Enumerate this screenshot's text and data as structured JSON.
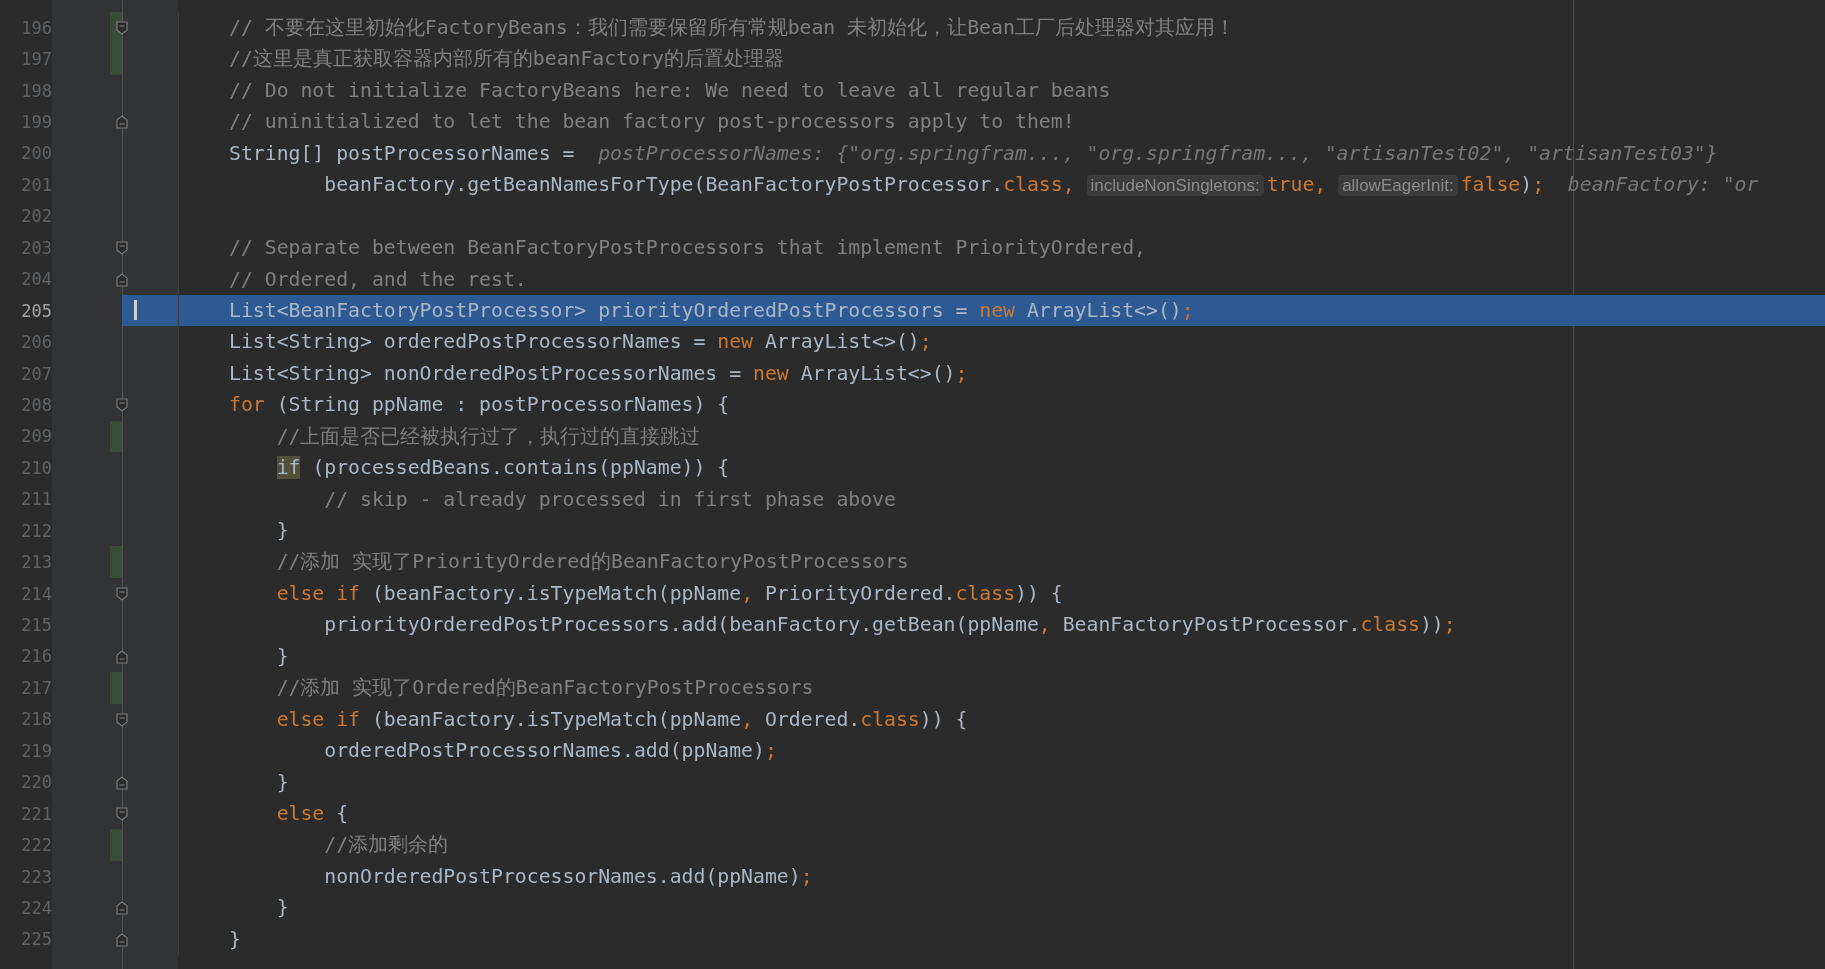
{
  "editor": {
    "lines": [
      {
        "number": "196",
        "changed": true,
        "kind": "fold-start",
        "selected": false,
        "tokens": [
          {
            "kind": "comment",
            "text": "// 不要在这里初始化FactoryBeans：我们需要保留所有常规bean 未初始化，让Bean工厂后处理器对其应用！"
          }
        ]
      },
      {
        "number": "197",
        "changed": true,
        "kind": "plain",
        "selected": false,
        "tokens": [
          {
            "kind": "comment",
            "text": "//这里是真正获取容器内部所有的beanFactory的后置处理器"
          }
        ]
      },
      {
        "number": "198",
        "changed": false,
        "kind": "plain",
        "selected": false,
        "tokens": [
          {
            "kind": "comment",
            "text": "// Do not initialize FactoryBeans here: We need to leave all regular beans"
          }
        ]
      },
      {
        "number": "199",
        "changed": false,
        "kind": "fold-end",
        "selected": false,
        "tokens": [
          {
            "kind": "comment",
            "text": "// uninitialized to let the bean factory post-processors apply to them!"
          }
        ]
      },
      {
        "number": "200",
        "changed": false,
        "kind": "plain",
        "selected": false,
        "tokens": [
          {
            "kind": "code",
            "text": "String[] postProcessorNames =  "
          },
          {
            "kind": "hint",
            "text": "postProcessorNames: {\"org.springfram..., \"org.springfram..., \"artisanTest02\", \"artisanTest03\"}"
          }
        ]
      },
      {
        "number": "201",
        "changed": false,
        "kind": "plain",
        "selected": false,
        "tokens": [
          {
            "kind": "code",
            "text": "        beanFactory.getBeanNamesForType(BeanFactoryPostProcessor."
          },
          {
            "kind": "keyword",
            "text": "class, "
          },
          {
            "kind": "inlay",
            "text": "includeNonSingletons:"
          },
          {
            "kind": "keyword",
            "text": "true, "
          },
          {
            "kind": "inlay",
            "text": "allowEagerInit:"
          },
          {
            "kind": "keyword",
            "text": "false"
          },
          {
            "kind": "code",
            "text": ")"
          },
          {
            "kind": "keyword",
            "text": ";  "
          },
          {
            "kind": "hint",
            "text": "beanFactory: \"or"
          }
        ]
      },
      {
        "number": "202",
        "changed": false,
        "kind": "plain",
        "selected": false
      },
      {
        "number": "203",
        "changed": false,
        "kind": "fold-start",
        "selected": false,
        "tokens": [
          {
            "kind": "comment",
            "text": "// Separate between BeanFactoryPostProcessors that implement PriorityOrdered,"
          }
        ]
      },
      {
        "number": "204",
        "changed": false,
        "kind": "fold-end",
        "selected": false,
        "tokens": [
          {
            "kind": "comment",
            "text": "// Ordered, and the rest."
          }
        ]
      },
      {
        "number": "205",
        "changed": false,
        "kind": "plain",
        "selected": true,
        "tokens": [
          {
            "kind": "code",
            "text": "List<BeanFactoryPostProcessor> priorityOrderedPostProcessors = "
          },
          {
            "kind": "keyword",
            "text": "new "
          },
          {
            "kind": "code",
            "text": "ArrayList<>()"
          },
          {
            "kind": "keyword",
            "text": ";"
          }
        ]
      },
      {
        "number": "206",
        "changed": false,
        "kind": "plain",
        "selected": false,
        "tokens": [
          {
            "kind": "code",
            "text": "List<String> orderedPostProcessorNames = "
          },
          {
            "kind": "keyword",
            "text": "new "
          },
          {
            "kind": "code",
            "text": "ArrayList<>()"
          },
          {
            "kind": "keyword",
            "text": ";"
          }
        ]
      },
      {
        "number": "207",
        "changed": false,
        "kind": "plain",
        "selected": false,
        "tokens": [
          {
            "kind": "code",
            "text": "List<String> nonOrderedPostProcessorNames = "
          },
          {
            "kind": "keyword",
            "text": "new "
          },
          {
            "kind": "code",
            "text": "ArrayList<>()"
          },
          {
            "kind": "keyword",
            "text": ";"
          }
        ]
      },
      {
        "number": "208",
        "changed": false,
        "kind": "fold-start",
        "selected": false,
        "tokens": [
          {
            "kind": "keyword",
            "text": "for "
          },
          {
            "kind": "code",
            "text": "(String ppName : postProcessorNames) {"
          }
        ]
      },
      {
        "number": "209",
        "changed": true,
        "kind": "plain",
        "selected": false,
        "tokens": [
          {
            "kind": "comment",
            "text": "    //上面是否已经被执行过了，执行过的直接跳过"
          }
        ]
      },
      {
        "number": "210",
        "changed": false,
        "kind": "plain",
        "selected": false,
        "tokens": [
          {
            "kind": "match",
            "text": "    if"
          },
          {
            "kind": "code",
            "text": " (processedBeans.contains(ppName)) {"
          }
        ]
      },
      {
        "number": "211",
        "changed": false,
        "kind": "plain",
        "selected": false,
        "tokens": [
          {
            "kind": "comment",
            "text": "        // skip - already processed in first phase above"
          }
        ]
      },
      {
        "number": "212",
        "changed": false,
        "kind": "plain",
        "selected": false,
        "tokens": [
          {
            "kind": "code",
            "text": "    }"
          }
        ]
      },
      {
        "number": "213",
        "changed": true,
        "kind": "plain",
        "selected": false,
        "tokens": [
          {
            "kind": "comment",
            "text": "    //添加 实现了PriorityOrdered的BeanFactoryPostProcessors"
          }
        ]
      },
      {
        "number": "214",
        "changed": false,
        "kind": "fold-start",
        "selected": false,
        "tokens": [
          {
            "kind": "keyword",
            "text": "    else if "
          },
          {
            "kind": "code",
            "text": "(beanFactory.isTypeMatch(ppName"
          },
          {
            "kind": "keyword",
            "text": ", "
          },
          {
            "kind": "code",
            "text": "PriorityOrdered."
          },
          {
            "kind": "keyword",
            "text": "class"
          },
          {
            "kind": "code",
            "text": ")) {"
          }
        ]
      },
      {
        "number": "215",
        "changed": false,
        "kind": "plain",
        "selected": false,
        "tokens": [
          {
            "kind": "code",
            "text": "        priorityOrderedPostProcessors.add(beanFactory.getBean(ppName"
          },
          {
            "kind": "keyword",
            "text": ", "
          },
          {
            "kind": "code",
            "text": "BeanFactoryPostProcessor."
          },
          {
            "kind": "keyword",
            "text": "class"
          },
          {
            "kind": "code",
            "text": "))"
          },
          {
            "kind": "keyword",
            "text": ";"
          }
        ]
      },
      {
        "number": "216",
        "changed": false,
        "kind": "fold-end",
        "selected": false,
        "tokens": [
          {
            "kind": "code",
            "text": "    }"
          }
        ]
      },
      {
        "number": "217",
        "changed": true,
        "kind": "plain",
        "selected": false,
        "tokens": [
          {
            "kind": "comment",
            "text": "    //添加 实现了Ordered的BeanFactoryPostProcessors"
          }
        ]
      },
      {
        "number": "218",
        "changed": false,
        "kind": "fold-start",
        "selected": false,
        "tokens": [
          {
            "kind": "keyword",
            "text": "    else if "
          },
          {
            "kind": "code",
            "text": "(beanFactory.isTypeMatch(ppName"
          },
          {
            "kind": "keyword",
            "text": ", "
          },
          {
            "kind": "code",
            "text": "Ordered."
          },
          {
            "kind": "keyword",
            "text": "class"
          },
          {
            "kind": "code",
            "text": ")) {"
          }
        ]
      },
      {
        "number": "219",
        "changed": false,
        "kind": "plain",
        "selected": false,
        "tokens": [
          {
            "kind": "code",
            "text": "        orderedPostProcessorNames.add(ppName)"
          },
          {
            "kind": "keyword",
            "text": ";"
          }
        ]
      },
      {
        "number": "220",
        "changed": false,
        "kind": "fold-end",
        "selected": false,
        "tokens": [
          {
            "kind": "code",
            "text": "    }"
          }
        ]
      },
      {
        "number": "221",
        "changed": false,
        "kind": "fold-start",
        "selected": false,
        "tokens": [
          {
            "kind": "keyword",
            "text": "    else "
          },
          {
            "kind": "code",
            "text": "{"
          }
        ]
      },
      {
        "number": "222",
        "changed": true,
        "kind": "plain",
        "selected": false,
        "tokens": [
          {
            "kind": "comment",
            "text": "        //添加剩余的"
          }
        ]
      },
      {
        "number": "223",
        "changed": false,
        "kind": "plain",
        "selected": false,
        "tokens": [
          {
            "kind": "code",
            "text": "        nonOrderedPostProcessorNames.add(ppName)"
          },
          {
            "kind": "keyword",
            "text": ";"
          }
        ]
      },
      {
        "number": "224",
        "changed": false,
        "kind": "fold-end",
        "selected": false,
        "tokens": [
          {
            "kind": "code",
            "text": "    }"
          }
        ]
      },
      {
        "number": "225",
        "changed": false,
        "kind": "fold-end",
        "selected": false,
        "tokens": [
          {
            "kind": "code",
            "text": "}"
          }
        ]
      }
    ]
  }
}
